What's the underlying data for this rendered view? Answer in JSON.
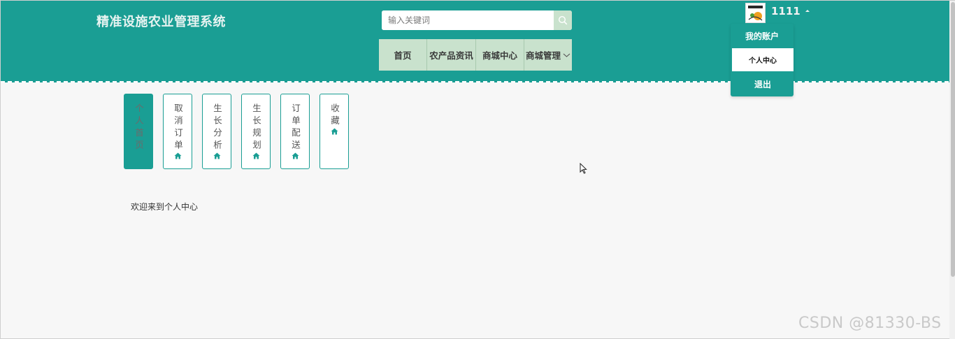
{
  "header": {
    "site_title": "精准设施农业管理系统",
    "bg_color": "#1a9e94",
    "search": {
      "placeholder": "输入关键词",
      "value": "",
      "icon": "search-icon"
    },
    "nav": [
      {
        "label": "首页"
      },
      {
        "label": "农产品资讯"
      },
      {
        "label": "商城中心"
      },
      {
        "label": "商城管理",
        "icon": "chevron-down-icon"
      }
    ],
    "user": {
      "name": "1111",
      "avatar_icon": "avatar-logo",
      "caret_icon": "caret-up-icon"
    },
    "account_menu": {
      "title": "我的账户",
      "items": [
        {
          "label": "个人中心",
          "active": true
        },
        {
          "label": "退出",
          "active": false
        }
      ]
    }
  },
  "sidebar": {
    "tabs": [
      {
        "label": "个人首页",
        "active": true
      },
      {
        "label": "取消订单",
        "icon": "home-icon"
      },
      {
        "label": "生长分析",
        "icon": "home-icon"
      },
      {
        "label": "生长规划",
        "icon": "home-icon"
      },
      {
        "label": "订单配送",
        "icon": "home-icon"
      },
      {
        "label": "收藏",
        "icon": "home-icon"
      }
    ],
    "accent_color": "#1a9e94"
  },
  "main": {
    "welcome_text": "欢迎来到个人中心"
  },
  "watermark": "CSDN @81330-BS"
}
